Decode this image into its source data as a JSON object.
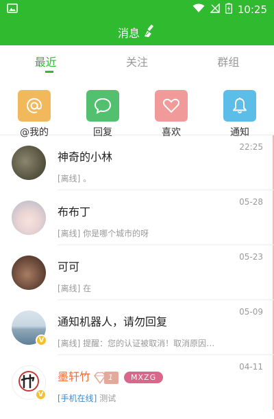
{
  "status_bar": {
    "time": "10:25"
  },
  "app_bar": {
    "title": "消息"
  },
  "tabs": [
    {
      "label": "最近",
      "active": true
    },
    {
      "label": "关注",
      "active": false
    },
    {
      "label": "群组",
      "active": false
    }
  ],
  "quick_actions": [
    {
      "label": "@我的",
      "icon": "at-icon",
      "color": "#f2b85c"
    },
    {
      "label": "回复",
      "icon": "chat-bubble-icon",
      "color": "#52c06e"
    },
    {
      "label": "喜欢",
      "icon": "heart-icon",
      "color": "#f19a9a"
    },
    {
      "label": "通知",
      "icon": "bell-icon",
      "color": "#5bbde8"
    }
  ],
  "conversations": [
    {
      "name": "神奇的小林",
      "message": "[离线] 。",
      "time": "22:25"
    },
    {
      "name": "布布丁",
      "message": "[离线] 你是哪个城市的呀",
      "time": "05-28"
    },
    {
      "name": "可可",
      "message": "[离线] 在",
      "time": "05-23"
    },
    {
      "name": "通知机器人，请勿回复",
      "message": "[离线] 提醒：您的认证被取消！取消原因：t...",
      "time": "05-09",
      "verified": true
    },
    {
      "name": "墨轩竹",
      "level": "1",
      "tag": "MXZG",
      "status": "[手机在线]",
      "message": "测试",
      "time": "04-11",
      "verified": true
    }
  ]
}
